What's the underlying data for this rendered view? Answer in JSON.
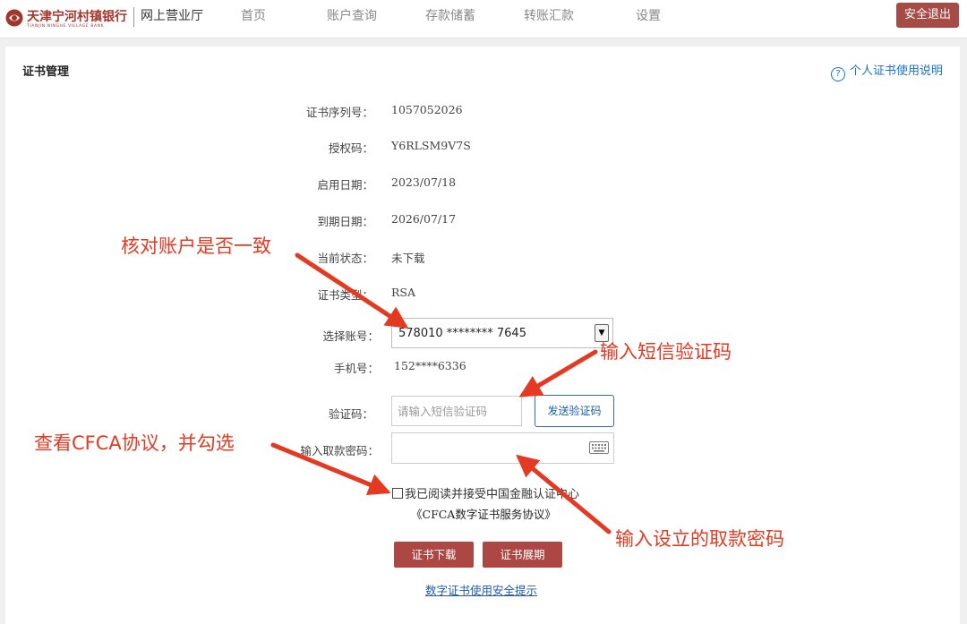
{
  "header": {
    "bank_name": "天津宁河村镇银行",
    "bank_name_en": "TIANJIN NINGHE VILLAGE BANK",
    "portal_name": "网上营业厅",
    "nav": [
      "首页",
      "账户查询",
      "存款储蓄",
      "转账汇款",
      "设置"
    ],
    "logout_label": "安全退出"
  },
  "panel": {
    "title": "证书管理",
    "help_label": "个人证书使用说明"
  },
  "cert": {
    "serial_label": "证书序列号：",
    "serial_value": "1057052026",
    "auth_label": "授权码：",
    "auth_value": "Y6RLSM9V7S",
    "start_label": "启用日期：",
    "start_value": "2023/07/18",
    "expire_label": "到期日期：",
    "expire_value": "2026/07/17",
    "status_label": "当前状态：",
    "status_value": "未下载",
    "type_label": "证书类型：",
    "type_value": "RSA"
  },
  "form": {
    "account_label": "选择账号：",
    "account_value": "578010 ******** 7645",
    "phone_label": "手机号：",
    "phone_value": "152****6336",
    "code_label": "验证码：",
    "code_placeholder": "请输入短信验证码",
    "send_code_label": "发送验证码",
    "pwd_label": "输入取款密码：",
    "agree_text": "我已阅读并接受中国金融认证中心",
    "agreement_link": "《CFCA数字证书服务协议》",
    "download_label": "证书下载",
    "extend_label": "证书展期",
    "safety_link": "数字证书使用安全提示"
  },
  "annotations": {
    "verify_account": "核对账户是否一致",
    "enter_sms": "输入短信验证码",
    "check_cfca": "查看CFCA协议，并勾选",
    "enter_pwd": "输入设立的取款密码"
  },
  "colors": {
    "brand": "#a84a46",
    "link": "#1a73c7",
    "annotation": "#e53a22"
  }
}
